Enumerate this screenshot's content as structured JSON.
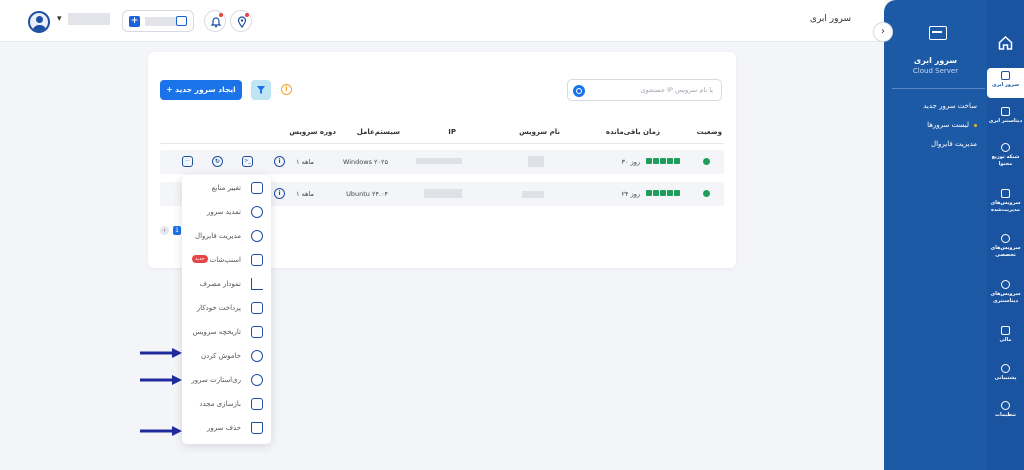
{
  "header": {
    "title": "سرور ابری"
  },
  "toolbar": {
    "create_label": "+  ایجاد سرور جدید",
    "search_placeholder": "جستجوی IP یا نام سرویس"
  },
  "table": {
    "headers": {
      "status": "وضعیت",
      "time_left": "زمان باقی‌مانده",
      "service_name": "نام سرویس",
      "ip": "IP",
      "os": "سیستم‌عامل",
      "period": "دوره سرویس"
    },
    "rows": [
      {
        "days": "۳۰ روز",
        "os": "Windows ۲۰۲۵",
        "period": "۱ ماهه"
      },
      {
        "days": "۲۴ روز",
        "os": "Ubuntu ۲۴.۰۴",
        "period": "۱ ماهه"
      }
    ]
  },
  "pager": {
    "page": "1",
    "prev": "‹"
  },
  "menu": {
    "items": [
      {
        "label": "تغییر منابع"
      },
      {
        "label": "تمدید سرور"
      },
      {
        "label": "مدیریت فایروال"
      },
      {
        "label": "اسنپ‌شات",
        "badge": "جدید"
      },
      {
        "label": "نمودار مصرف"
      },
      {
        "label": "پرداخت خودکار"
      },
      {
        "label": "تاریخچه سرویس"
      },
      {
        "label": "خاموش کردن"
      },
      {
        "label": "ری‌استارت سرور"
      },
      {
        "label": "بازسازی مجدد"
      },
      {
        "label": "حذف سرور"
      }
    ]
  },
  "subpanel": {
    "title": "سرور ابری",
    "subtitle": "Cloud Server",
    "items": [
      {
        "label": "ساخت سرور جدید"
      },
      {
        "label": "لیست سرورها"
      },
      {
        "label": "مدیریت فایروال"
      }
    ]
  },
  "rail": {
    "items": [
      {
        "label": "سرور ابری"
      },
      {
        "label": "دیتاسنتر ابری"
      },
      {
        "label": "شبکه توزیع محتوا"
      },
      {
        "label": "سرویس‌های مدیریت‌شده"
      },
      {
        "label": "سرویس‌های تخصصی"
      },
      {
        "label": "سرویس‌های دیتاسنتری"
      },
      {
        "label": "مالی"
      },
      {
        "label": "پشتیبانی"
      },
      {
        "label": "تنظیمات"
      }
    ]
  },
  "colors": {
    "primary": "#1a73e8",
    "sidebar": "#1c5aa6",
    "rail": "#1a54a0",
    "success": "#1e9e5a",
    "danger": "#e64545"
  }
}
